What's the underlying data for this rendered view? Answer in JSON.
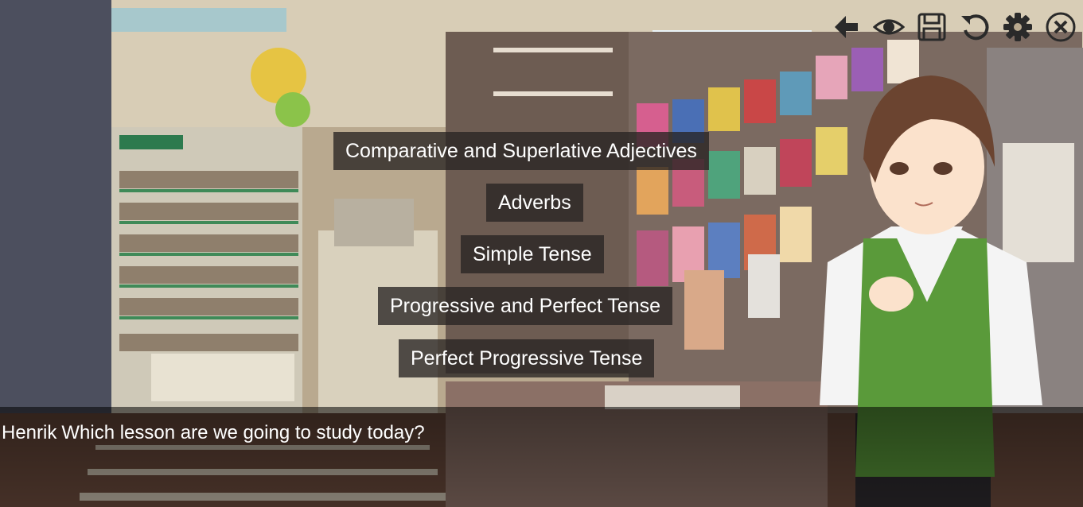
{
  "toolbar": {
    "icons": [
      "back-arrow-icon",
      "eye-icon",
      "save-icon",
      "undo-icon",
      "gear-icon",
      "close-icon"
    ]
  },
  "choices": [
    "Comparative and Superlative Adjectives",
    "Adverbs",
    "Simple Tense",
    "Progressive and Perfect Tense",
    "Perfect Progressive Tense"
  ],
  "dialogue": {
    "speaker": "Henrik",
    "text": "Which lesson are we going to study today?"
  },
  "colors": {
    "icon": "#2a2a2a",
    "choice_bg": "rgba(40,36,34,0.78)",
    "vest": "#5a9a3a",
    "hair": "#6b4430"
  }
}
